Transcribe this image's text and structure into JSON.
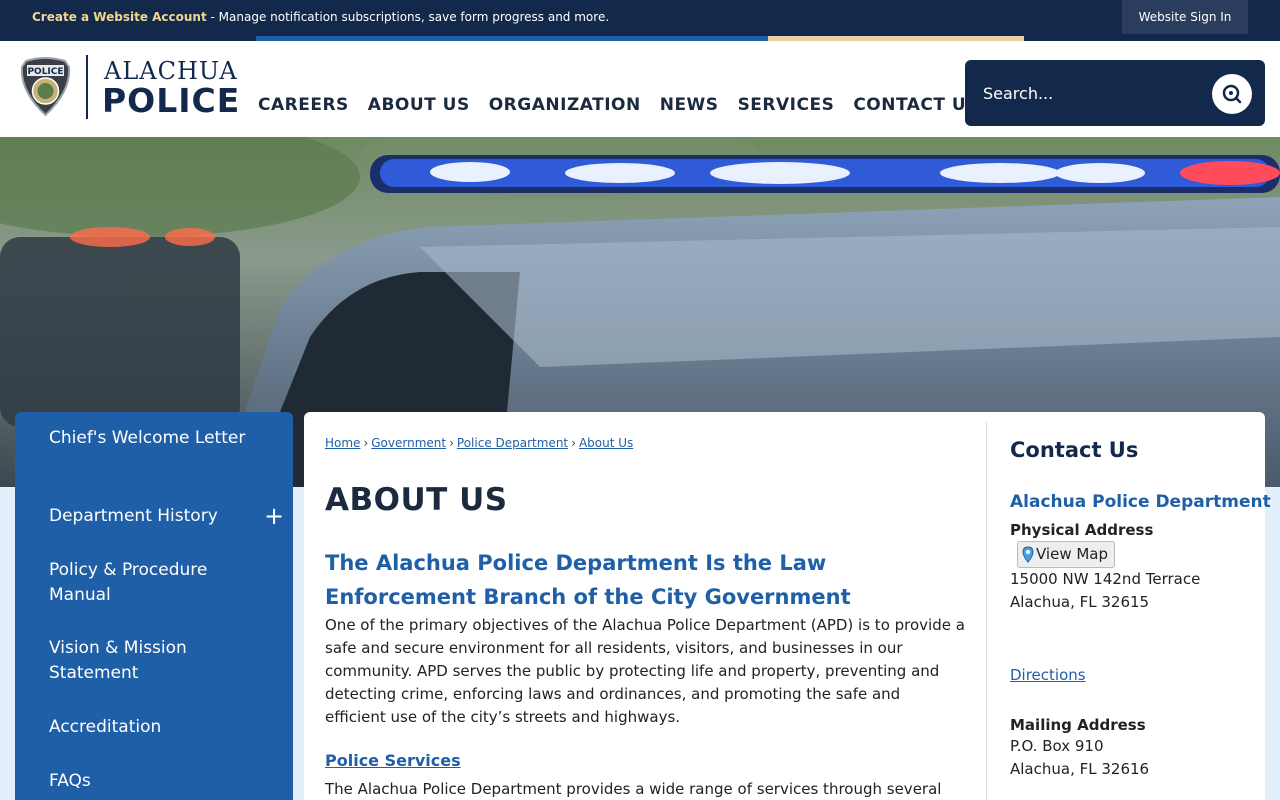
{
  "topbar": {
    "create_account": "Create a Website Account",
    "message": " - Manage notification subscriptions, save form progress and more.",
    "sign_in": "Website Sign In"
  },
  "colors": {
    "navy": "#13294b",
    "blue": "#1f5fa8",
    "gold": "#f2d68e",
    "stripe_colors": [
      "#13294b",
      "#1f5fa8",
      "#1f5fa8",
      "#e6d3a3",
      "#13294b"
    ]
  },
  "logo": {
    "line1": "ALACHUA",
    "line2": "POLICE",
    "badge_icon": "police-badge-icon"
  },
  "nav": {
    "items": [
      "CAREERS",
      "ABOUT US",
      "ORGANIZATION",
      "NEWS",
      "SERVICES",
      "CONTACT US"
    ]
  },
  "search": {
    "placeholder": "Search...",
    "icon": "search-icon"
  },
  "sidebar": {
    "items": [
      {
        "label": "Chief's Welcome Letter"
      },
      {
        "label": "Department History",
        "expandable": true
      },
      {
        "label": "Policy & Procedure Manual"
      },
      {
        "label": "Vision & Mission Statement"
      },
      {
        "label": "Accreditation"
      },
      {
        "label": "FAQs"
      }
    ],
    "expand_symbol": "+"
  },
  "breadcrumb": {
    "items": [
      "Home",
      "Government",
      "Police Department",
      "About Us"
    ],
    "separator": "›"
  },
  "main": {
    "title": "ABOUT US",
    "subheading": "The Alachua Police Department Is the Law Enforcement Branch of the City Government",
    "paragraph": "One of the primary objectives of the Alachua Police Department (APD) is to provide a safe and secure environment for all residents, visitors, and businesses in our community. APD serves the public by protecting life and property, preventing and detecting crime, enforcing laws and ordinances, and promoting the safe and efficient use of the city’s streets and highways.",
    "services_link": "Police Services",
    "services_paragraph": "The Alachua Police Department provides a wide range of services through several"
  },
  "contact": {
    "title": "Contact Us",
    "org": "Alachua Police Department",
    "physical_label": "Physical Address",
    "view_map": "View Map",
    "physical_line1": "15000 NW 142nd Terrace",
    "physical_line2": "Alachua, FL 32615",
    "directions": "Directions",
    "mailing_label": "Mailing Address",
    "mailing_line1": "P.O. Box 910",
    "mailing_line2": "Alachua, FL 32616"
  }
}
